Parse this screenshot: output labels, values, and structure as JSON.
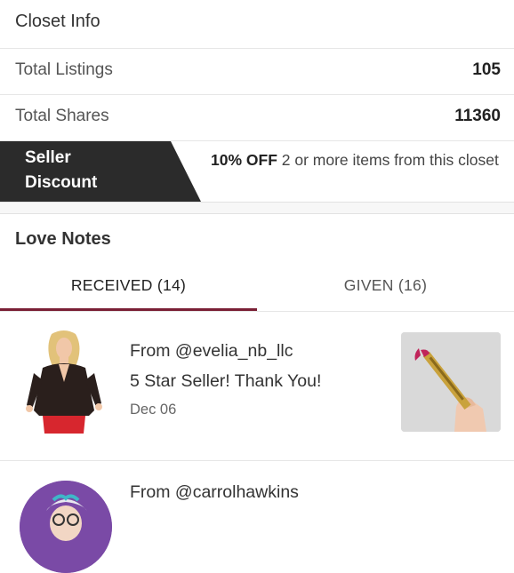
{
  "closet_info": {
    "title": "Closet Info",
    "rows": [
      {
        "label": "Total Listings",
        "value": "105"
      },
      {
        "label": "Total Shares",
        "value": "11360"
      }
    ]
  },
  "seller_discount": {
    "label_line1": "Seller",
    "label_line2": "Discount",
    "offer_bold": "10% OFF",
    "offer_rest": " 2 or more items from this closet"
  },
  "love_notes": {
    "title": "Love Notes",
    "tabs": [
      {
        "label": "RECEIVED (14)",
        "active": true
      },
      {
        "label": "GIVEN (16)",
        "active": false
      }
    ],
    "notes": [
      {
        "from": "From @evelia_nb_llc",
        "message": "5 Star Seller! Thank You!",
        "date": "Dec 06"
      },
      {
        "from": "From @carrolhawkins"
      }
    ]
  },
  "colors": {
    "active_tab_underline": "#7a1f35",
    "discount_banner": "#2b2b2b",
    "avatar2_bg": "#7a4aa6"
  }
}
